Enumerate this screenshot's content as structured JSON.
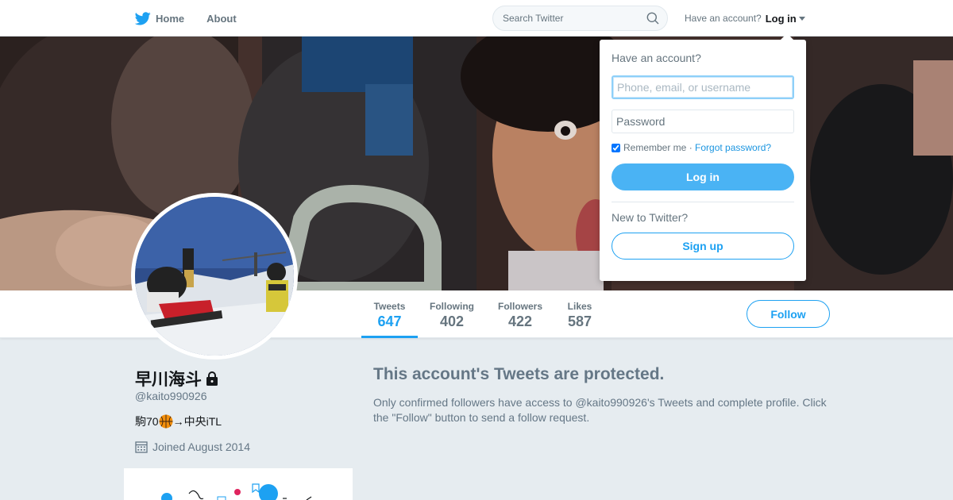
{
  "nav": {
    "home_label": "Home",
    "about_label": "About",
    "search_placeholder": "Search Twitter",
    "have_account": "Have an account?",
    "login_label": "Log in"
  },
  "login_dropdown": {
    "title": "Have an account?",
    "username_placeholder": "Phone, email, or username",
    "password_placeholder": "Password",
    "remember_label": "Remember me",
    "separator": " · ",
    "forgot_label": "Forgot password?",
    "remember_checked": true,
    "login_button": "Log in",
    "new_to_twitter": "New to Twitter?",
    "signup_button": "Sign up"
  },
  "stats": [
    {
      "label": "Tweets",
      "value": "647",
      "active": true
    },
    {
      "label": "Following",
      "value": "402",
      "active": false
    },
    {
      "label": "Followers",
      "value": "422",
      "active": false
    },
    {
      "label": "Likes",
      "value": "587",
      "active": false
    }
  ],
  "follow_button": "Follow",
  "profile": {
    "name": "早川海斗",
    "handle": "@kaito990926",
    "bio_prefix": "駒70",
    "bio_suffix": "→中央iTL",
    "joined": "Joined August 2014"
  },
  "protected": {
    "title": "This account's Tweets are protected.",
    "text": "Only confirmed followers have access to @kaito990926's Tweets and complete profile. Click the \"Follow\" button to send a follow request."
  },
  "colors": {
    "brand_blue": "#1da1f2",
    "login_blue": "#4ab3f4",
    "page_bg": "#e6ecf0"
  },
  "icons": [
    "twitter-bird-icon",
    "search-icon",
    "caret-down-icon",
    "lock-icon",
    "basketball-icon",
    "calendar-icon"
  ]
}
